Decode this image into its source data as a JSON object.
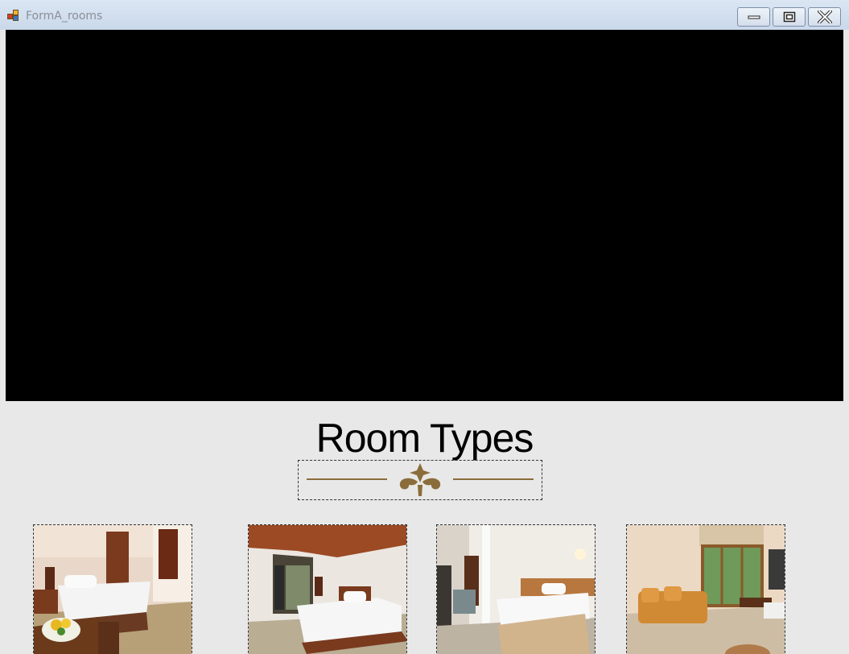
{
  "window": {
    "title": "FormA_rooms",
    "buttons": {
      "minimize": "minimize",
      "maximize": "maximize",
      "close": "close"
    }
  },
  "video_panel": {
    "background": "#000000"
  },
  "heading": {
    "text": "Room Types"
  },
  "ornament": {
    "icon": "fleur-de-lis-divider-icon",
    "color": "#8a6d3b"
  },
  "rooms": [
    {
      "name": "room-image-1",
      "icon": "bedroom-photo"
    },
    {
      "name": "room-image-2",
      "icon": "bedroom-photo"
    },
    {
      "name": "room-image-3",
      "icon": "bedroom-photo"
    },
    {
      "name": "room-image-4",
      "icon": "living-room-photo"
    }
  ]
}
